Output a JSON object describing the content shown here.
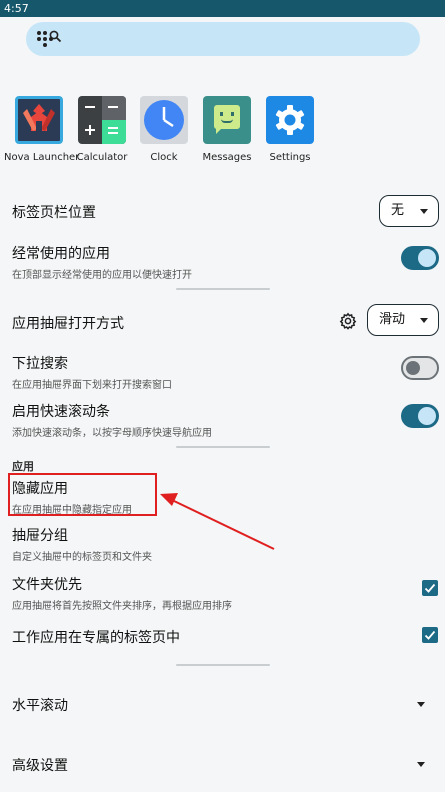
{
  "status_bar": {
    "time": "4:57"
  },
  "dock_apps": [
    {
      "label": "Nova Launcher",
      "icon": "nova-launcher-icon"
    },
    {
      "label": "Calculator",
      "icon": "calculator-icon"
    },
    {
      "label": "Clock",
      "icon": "clock-icon"
    },
    {
      "label": "Messages",
      "icon": "messages-icon"
    },
    {
      "label": "Settings",
      "icon": "settings-gear-icon"
    }
  ],
  "settings": {
    "tab_bar_position": {
      "title": "标签页栏位置",
      "value": "无"
    },
    "frequent_apps": {
      "title": "经常使用的应用",
      "subtitle": "在顶部显示经常使用的应用以便快速打开",
      "enabled": true
    },
    "drawer_open_style": {
      "title": "应用抽屉打开方式",
      "value": "滑动"
    },
    "pull_down_search": {
      "title": "下拉搜索",
      "subtitle": "在应用抽屉界面下划来打开搜索窗口",
      "enabled": false
    },
    "fast_scrollbar": {
      "title": "启用快速滚动条",
      "subtitle": "添加快速滚动条，以按字母顺序快速导航应用",
      "enabled": true
    },
    "section_apps": "应用",
    "hide_apps": {
      "title": "隐藏应用",
      "subtitle": "在应用抽屉中隐藏指定应用"
    },
    "drawer_groups": {
      "title": "抽屉分组",
      "subtitle": "自定义抽屉中的标签页和文件夹"
    },
    "folders_first": {
      "title": "文件夹优先",
      "subtitle": "应用抽屉将首先按照文件夹排序，再根据应用排序",
      "checked": true
    },
    "work_apps_tab": {
      "title": "工作应用在专属的标签页中",
      "checked": true
    },
    "horizontal_scroll": {
      "title": "水平滚动"
    },
    "advanced": {
      "title": "高级设置"
    }
  },
  "colors": {
    "accent": "#1d6a86",
    "search_bar": "#c6e6f7",
    "highlight": "#e02020"
  }
}
